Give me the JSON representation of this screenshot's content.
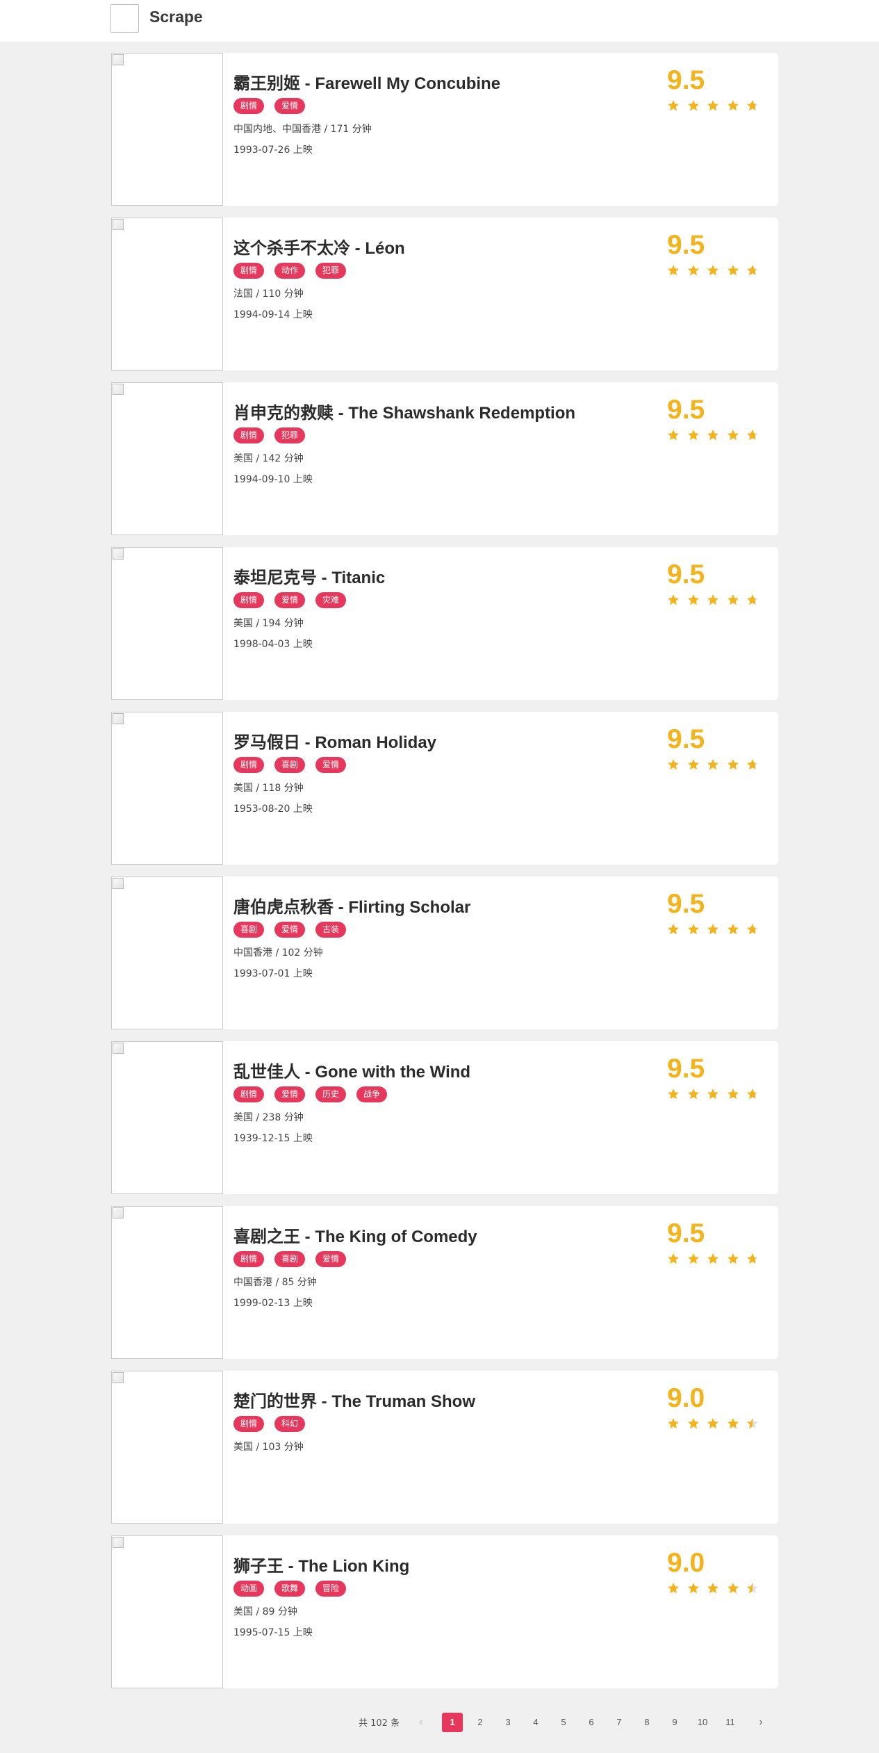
{
  "header": {
    "brand": "Scrape",
    "logo_icon": "broken-image-icon"
  },
  "movies": [
    {
      "title": "霸王别姬 - Farewell My Concubine",
      "tags": [
        "剧情",
        "爱情"
      ],
      "info": "中国内地、中国香港 / 171 分钟",
      "release": "1993-07-26 上映",
      "score": "9.5",
      "rating_stars": 4.75
    },
    {
      "title": "这个杀手不太冷 - Léon",
      "tags": [
        "剧情",
        "动作",
        "犯罪"
      ],
      "info": "法国 / 110 分钟",
      "release": "1994-09-14 上映",
      "score": "9.5",
      "rating_stars": 4.75
    },
    {
      "title": "肖申克的救赎 - The Shawshank Redemption",
      "tags": [
        "剧情",
        "犯罪"
      ],
      "info": "美国 / 142 分钟",
      "release": "1994-09-10 上映",
      "score": "9.5",
      "rating_stars": 4.75
    },
    {
      "title": "泰坦尼克号 - Titanic",
      "tags": [
        "剧情",
        "爱情",
        "灾难"
      ],
      "info": "美国 / 194 分钟",
      "release": "1998-04-03 上映",
      "score": "9.5",
      "rating_stars": 4.75
    },
    {
      "title": "罗马假日 - Roman Holiday",
      "tags": [
        "剧情",
        "喜剧",
        "爱情"
      ],
      "info": "美国 / 118 分钟",
      "release": "1953-08-20 上映",
      "score": "9.5",
      "rating_stars": 4.75
    },
    {
      "title": "唐伯虎点秋香 - Flirting Scholar",
      "tags": [
        "喜剧",
        "爱情",
        "古装"
      ],
      "info": "中国香港 / 102 分钟",
      "release": "1993-07-01 上映",
      "score": "9.5",
      "rating_stars": 4.75
    },
    {
      "title": "乱世佳人 - Gone with the Wind",
      "tags": [
        "剧情",
        "爱情",
        "历史",
        "战争"
      ],
      "info": "美国 / 238 分钟",
      "release": "1939-12-15 上映",
      "score": "9.5",
      "rating_stars": 4.75
    },
    {
      "title": "喜剧之王 - The King of Comedy",
      "tags": [
        "剧情",
        "喜剧",
        "爱情"
      ],
      "info": "中国香港 / 85 分钟",
      "release": "1999-02-13 上映",
      "score": "9.5",
      "rating_stars": 4.75
    },
    {
      "title": "楚门的世界 - The Truman Show",
      "tags": [
        "剧情",
        "科幻"
      ],
      "info": "美国 / 103 分钟",
      "release": "",
      "score": "9.0",
      "rating_stars": 4.5
    },
    {
      "title": "狮子王 - The Lion King",
      "tags": [
        "动画",
        "歌舞",
        "冒险"
      ],
      "info": "美国 / 89 分钟",
      "release": "1995-07-15 上映",
      "score": "9.0",
      "rating_stars": 4.5
    }
  ],
  "pagination": {
    "total": "共 102 条",
    "pages": [
      "1",
      "2",
      "3",
      "4",
      "5",
      "6",
      "7",
      "8",
      "9",
      "10",
      "11"
    ],
    "current": "1",
    "prev_icon": "chevron-left-icon",
    "next_icon": "chevron-right-icon",
    "prev_glyph": "‹",
    "next_glyph": "›"
  },
  "colors": {
    "accent": "#e6385c",
    "score": "#f5b31b",
    "star_empty": "#e0e0e0"
  }
}
